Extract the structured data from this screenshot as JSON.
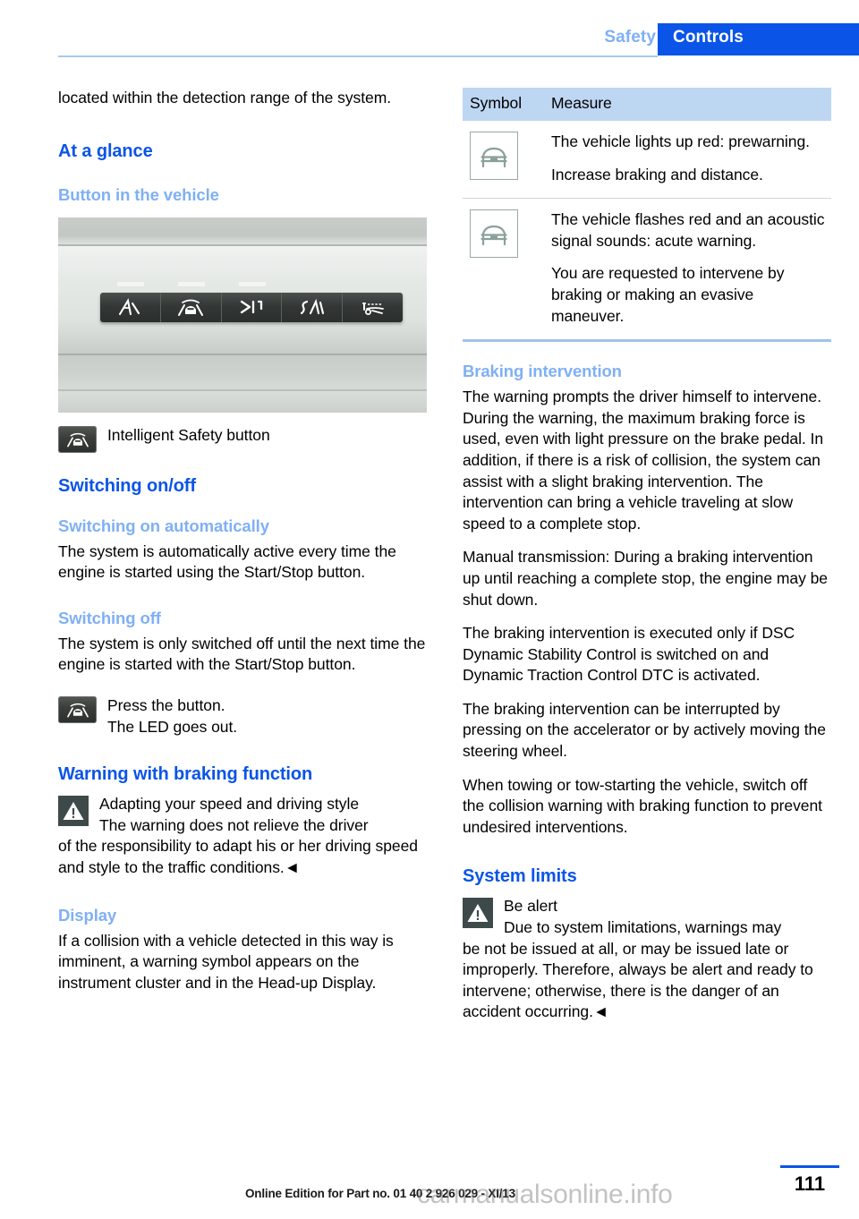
{
  "header": {
    "tab_inactive": "Safety",
    "tab_active": "Controls",
    "accent_blue": "#0a54e8",
    "light_blue": "#7fb0f5"
  },
  "left": {
    "continued_paragraph": "located within the detection range of the system.",
    "h_at_a_glance": "At a glance",
    "h_button_in_vehicle": "Button in the vehicle",
    "figure_dashboard": {
      "icon": "dashboard-button-panel-photo",
      "button_icons": [
        "lane-departure-warning-icon",
        "intelligent-safety-icon",
        "high-beam-assistant-icon",
        "lane-change-warning-icon",
        "night-vision-icon"
      ],
      "led_count": 3
    },
    "caption_button": {
      "icon": "intelligent-safety-button-icon",
      "label": "Intelligent Safety button"
    },
    "h_switching_onoff": "Switching on/off",
    "h_switching_on_auto": "Switching on automatically",
    "p_switching_on_auto": "The system is automatically active every time the engine is started using the Start/Stop button.",
    "h_switching_off": "Switching off",
    "p_switching_off": "The system is only switched off until the next time the engine is started with the Start/Stop button.",
    "step_press": {
      "icon": "intelligent-safety-button-icon",
      "line1": "Press the button.",
      "line2": "The LED goes out."
    },
    "h_warning_braking": "Warning with braking function",
    "warning_box": {
      "icon": "warning-triangle-icon",
      "title": "Adapting your speed and driving style",
      "body_indent": "The warning does not relieve the driver",
      "body_rest": "of the responsibility to adapt his or her driving speed and style to the traffic conditions.◄"
    },
    "h_display": "Display",
    "p_display": "If a collision with a vehicle detected in this way is imminent, a warning symbol appears on the instrument cluster and in the Head-up Display."
  },
  "right": {
    "table": {
      "headers": [
        "Symbol",
        "Measure"
      ],
      "rows": [
        {
          "icon": "car-front-symbol-icon",
          "paragraphs": [
            "The vehicle lights up red: prewarning.",
            "Increase braking and distance."
          ]
        },
        {
          "icon": "car-front-symbol-icon",
          "paragraphs": [
            "The vehicle flashes red and an acoustic signal sounds: acute warning.",
            "You are requested to intervene by braking or making an evasive maneuver."
          ]
        }
      ]
    },
    "h_braking_intervention": "Braking intervention",
    "p_braking_1": "The warning prompts the driver himself to intervene. During the warning, the maximum braking force is used, even with light pressure on the brake pedal. In addition, if there is a risk of collision, the system can assist with a slight braking intervention. The intervention can bring a vehicle traveling at slow speed to a complete stop.",
    "p_braking_2": "Manual transmission: During a braking intervention up until reaching a complete stop, the engine may be shut down.",
    "p_braking_3": "The braking intervention is executed only if DSC Dynamic Stability Control is switched on and Dynamic Traction Control DTC is activated.",
    "p_braking_4": "The braking intervention can be interrupted by pressing on the accelerator or by actively moving the steering wheel.",
    "p_braking_5": "When towing or tow-starting the vehicle, switch off the collision warning with braking function to prevent undesired interventions.",
    "h_system_limits": "System limits",
    "warning_box": {
      "icon": "warning-triangle-icon",
      "title": "Be alert",
      "body_indent": "Due to system limitations, warnings may",
      "body_rest": "be not be issued at all, or may be issued late or improperly. Therefore, always be alert and ready to intervene; otherwise, there is the danger of an accident occurring.◄"
    }
  },
  "footer": {
    "edition_note": "Online Edition for Part no. 01 40 2 926 029 - XI/13",
    "page_number": "111",
    "watermark": "carmanualsonline.info"
  }
}
